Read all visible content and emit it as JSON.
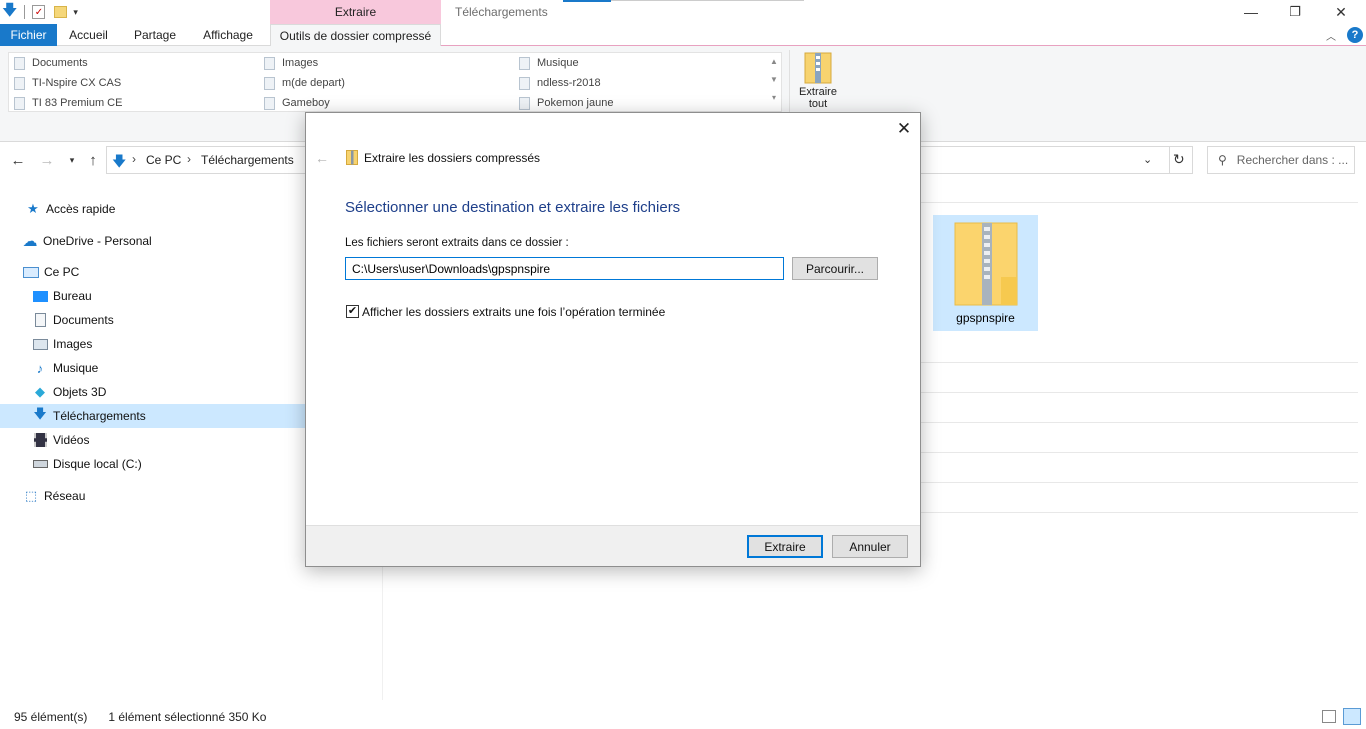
{
  "window": {
    "title": "Téléchargements",
    "context_group": "Extraire",
    "controls": {
      "minimize": "—",
      "maximize": "❐",
      "close": "✕"
    }
  },
  "tabs": {
    "file": "Fichier",
    "home": "Accueil",
    "share": "Partage",
    "view": "Affichage",
    "compressed": "Outils de dossier compressé"
  },
  "ribbon": {
    "destinations": [
      [
        "Documents",
        "Images",
        "Musique"
      ],
      [
        "TI-Nspire CX CAS",
        "m(de depart)",
        "ndless-r2018"
      ],
      [
        "TI 83 Premium CE",
        "Gameboy",
        "Pokemon jaune"
      ]
    ],
    "extract_all_line1": "Extraire",
    "extract_all_line2": "tout"
  },
  "address": {
    "crumbs": [
      "Ce PC",
      "Téléchargements"
    ],
    "search_placeholder": "Rechercher dans : ..."
  },
  "nav": {
    "quick_access": "Accès rapide",
    "onedrive": "OneDrive - Personal",
    "this_pc": "Ce PC",
    "items": [
      "Bureau",
      "Documents",
      "Images",
      "Musique",
      "Objets 3D",
      "Téléchargements",
      "Vidéos",
      "Disque local (C:)"
    ],
    "network": "Réseau"
  },
  "content": {
    "selected_file": "gpspnspire"
  },
  "status": {
    "count": "95 élément(s)",
    "selection": "1 élément sélectionné  350 Ko"
  },
  "dialog": {
    "title": "Extraire les dossiers compressés",
    "heading": "Sélectionner une destination et extraire les fichiers",
    "label": "Les fichiers seront extraits dans ce dossier :",
    "path": "C:\\Users\\user\\Downloads\\gpspnspire",
    "browse": "Parcourir...",
    "checkbox_label": "Afficher les dossiers extraits une fois l’opération terminée",
    "checkbox_checked": true,
    "extract": "Extraire",
    "cancel": "Annuler"
  }
}
